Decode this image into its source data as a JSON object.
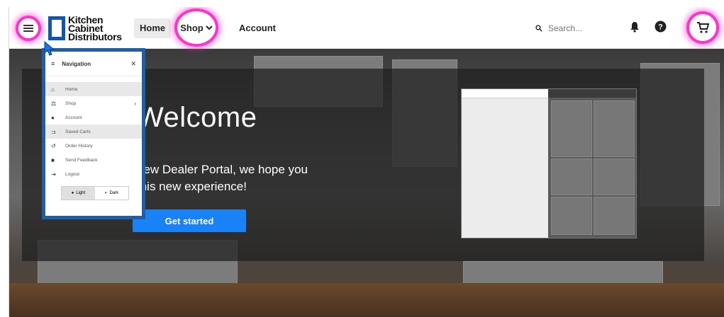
{
  "brand": {
    "line1": "Kitchen",
    "line2": "Cabinet",
    "line3": "Distributors"
  },
  "nav": {
    "home": "Home",
    "shop": "Shop",
    "account": "Account"
  },
  "search": {
    "placeholder": "Search..."
  },
  "hero": {
    "title": "Welcome",
    "subtitle_line1": "new Dealer Portal, we hope you",
    "subtitle_line2": "this new experience!",
    "cta": "Get started"
  },
  "drawer": {
    "title": "Navigation",
    "items": [
      {
        "label": "Home",
        "icon": "home-icon"
      },
      {
        "label": "Shop",
        "icon": "basket-icon"
      },
      {
        "label": "Account",
        "icon": "account-circle-icon"
      },
      {
        "label": "Saved Carts",
        "icon": "cart-icon"
      },
      {
        "label": "Order History",
        "icon": "history-icon"
      },
      {
        "label": "Send Feedback",
        "icon": "feedback-icon"
      },
      {
        "label": "Logout",
        "icon": "logout-icon"
      }
    ],
    "theme_light": "Light",
    "theme_dark": "Dark"
  },
  "colors": {
    "highlight": "#ff33cc",
    "brand": "#0f56b3",
    "cta": "#1a82f7",
    "drawer_border": "#1f5fa8"
  }
}
